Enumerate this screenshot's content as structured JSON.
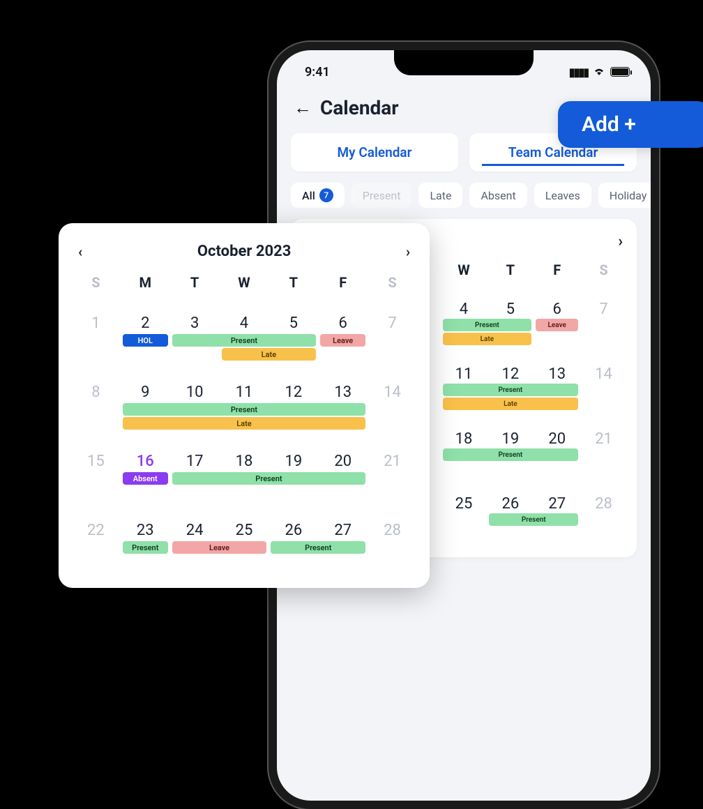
{
  "statusBar": {
    "time": "9:41"
  },
  "header": {
    "title": "Calendar",
    "addLabel": "Add +"
  },
  "tabs": {
    "my": "My Calendar",
    "team": "Team Calendar",
    "active": "team"
  },
  "filters": {
    "all": "All",
    "allCount": "7",
    "present": "Present",
    "late": "Late",
    "absent": "Absent",
    "leaves": "Leaves",
    "holiday": "Holiday"
  },
  "month": {
    "label": "October 2023"
  },
  "dow": [
    "S",
    "M",
    "T",
    "W",
    "T",
    "F",
    "S"
  ],
  "weeks": [
    {
      "days": [
        {
          "n": "1",
          "mute": true
        },
        {
          "n": "2"
        },
        {
          "n": "3"
        },
        {
          "n": "4"
        },
        {
          "n": "5"
        },
        {
          "n": "6"
        },
        {
          "n": "7",
          "mute": true
        }
      ],
      "bands": [
        {
          "label": "HOL",
          "cls": "c-hol",
          "startCol": 2,
          "span": 1,
          "row": 0
        },
        {
          "label": "Present",
          "cls": "c-present",
          "startCol": 3,
          "span": 3,
          "row": 0
        },
        {
          "label": "Late",
          "cls": "c-late",
          "startCol": 4,
          "span": 2,
          "row": 1
        },
        {
          "label": "Leave",
          "cls": "c-leave",
          "startCol": 6,
          "span": 1,
          "row": 0
        }
      ]
    },
    {
      "days": [
        {
          "n": "8",
          "mute": true
        },
        {
          "n": "9"
        },
        {
          "n": "10"
        },
        {
          "n": "11"
        },
        {
          "n": "12"
        },
        {
          "n": "13"
        },
        {
          "n": "14",
          "mute": true
        }
      ],
      "bands": [
        {
          "label": "Present",
          "cls": "c-present",
          "startCol": 2,
          "span": 5,
          "row": 0
        },
        {
          "label": "Late",
          "cls": "c-late",
          "startCol": 2,
          "span": 5,
          "row": 1
        }
      ]
    },
    {
      "days": [
        {
          "n": "15",
          "mute": true
        },
        {
          "n": "16",
          "hilite": true
        },
        {
          "n": "17"
        },
        {
          "n": "18"
        },
        {
          "n": "19"
        },
        {
          "n": "20"
        },
        {
          "n": "21",
          "mute": true
        }
      ],
      "bands": [
        {
          "label": "Absent",
          "cls": "c-absent",
          "startCol": 2,
          "span": 1,
          "row": 0
        },
        {
          "label": "Present",
          "cls": "c-present",
          "startCol": 3,
          "span": 4,
          "row": 0
        }
      ]
    },
    {
      "days": [
        {
          "n": "22",
          "mute": true
        },
        {
          "n": "23"
        },
        {
          "n": "24"
        },
        {
          "n": "25"
        },
        {
          "n": "26"
        },
        {
          "n": "27"
        },
        {
          "n": "28",
          "mute": true
        }
      ],
      "bands": [
        {
          "label": "Present",
          "cls": "c-present",
          "startCol": 2,
          "span": 1,
          "row": 0
        },
        {
          "label": "Leave",
          "cls": "c-leave",
          "startCol": 3,
          "span": 2,
          "row": 0
        },
        {
          "label": "Present",
          "cls": "c-present",
          "startCol": 5,
          "span": 2,
          "row": 0
        }
      ]
    }
  ],
  "phoneWeeks": [
    {
      "days": [
        {
          "n": "4"
        },
        {
          "n": "5"
        },
        {
          "n": "6"
        },
        {
          "n": "7",
          "mute": true
        }
      ],
      "offset": 3,
      "bands": [
        {
          "label": "Present",
          "cls": "c-present",
          "startCol": 1,
          "span": 2,
          "row": 0,
          "sm": true
        },
        {
          "label": "Late",
          "cls": "c-late",
          "startCol": 1,
          "span": 2,
          "row": 1,
          "sm": true
        },
        {
          "label": "Leave",
          "cls": "c-leave",
          "startCol": 3,
          "span": 1,
          "row": 0,
          "sm": true
        }
      ]
    },
    {
      "days": [
        {
          "n": "11"
        },
        {
          "n": "12"
        },
        {
          "n": "13"
        },
        {
          "n": "14",
          "mute": true
        }
      ],
      "offset": 3,
      "bands": [
        {
          "label": "Present",
          "cls": "c-present",
          "startCol": 1,
          "span": 3,
          "row": 0,
          "sm": true
        },
        {
          "label": "Late",
          "cls": "c-late",
          "startCol": 1,
          "span": 3,
          "row": 1,
          "sm": true
        }
      ]
    },
    {
      "days": [
        {
          "n": "18"
        },
        {
          "n": "19"
        },
        {
          "n": "20"
        },
        {
          "n": "21",
          "mute": true
        }
      ],
      "offset": 3,
      "bands": [
        {
          "label": "Present",
          "cls": "c-present",
          "startCol": 1,
          "span": 3,
          "row": 0,
          "sm": true
        }
      ]
    },
    {
      "days": [
        {
          "n": "25"
        },
        {
          "n": "26"
        },
        {
          "n": "27"
        },
        {
          "n": "28",
          "mute": true
        }
      ],
      "offset": 3,
      "bands": [
        {
          "label": "Present",
          "cls": "c-present",
          "startCol": 2,
          "span": 2,
          "row": 0,
          "sm": true
        }
      ]
    }
  ]
}
